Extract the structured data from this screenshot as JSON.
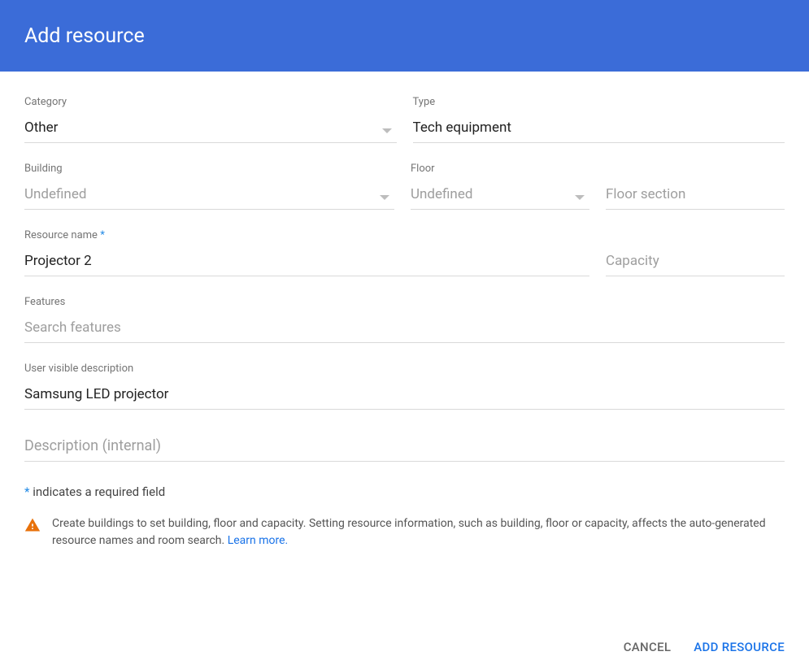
{
  "header": {
    "title": "Add resource"
  },
  "fields": {
    "category": {
      "label": "Category",
      "value": "Other"
    },
    "type": {
      "label": "Type",
      "value": "Tech equipment"
    },
    "building": {
      "label": "Building",
      "value": "Undefined"
    },
    "floor": {
      "label": "Floor",
      "value": "Undefined"
    },
    "floor_section": {
      "placeholder": "Floor section",
      "value": ""
    },
    "resource_name": {
      "label": "Resource name",
      "required": true,
      "value": "Projector 2"
    },
    "capacity": {
      "placeholder": "Capacity",
      "value": ""
    },
    "features": {
      "label": "Features",
      "placeholder": "Search features",
      "value": ""
    },
    "user_desc": {
      "label": "User visible description",
      "value": "Samsung LED projector"
    },
    "internal_desc": {
      "placeholder": "Description (internal)",
      "value": ""
    }
  },
  "required_note": "indicates a required field",
  "hint": {
    "text": "Create buildings to set building, floor and capacity. Setting resource information, such as building, floor or capacity, affects the auto-generated resource names and room search. ",
    "link": "Learn more."
  },
  "buttons": {
    "cancel": "CANCEL",
    "add": "ADD RESOURCE"
  }
}
